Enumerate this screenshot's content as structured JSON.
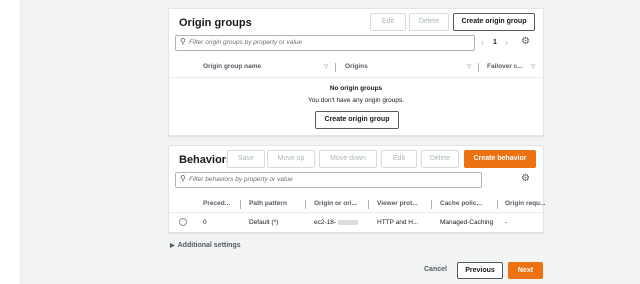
{
  "origin_groups": {
    "title": "Origin groups",
    "edit_label": "Edit",
    "delete_label": "Delete",
    "create_label": "Create origin group",
    "search_placeholder": "Filter origin groups by property or value",
    "page_number": "1",
    "columns": [
      "Origin group name",
      "Origins",
      "Failover c..."
    ],
    "empty_title": "No origin groups",
    "empty_message": "You don't have any origin groups.",
    "empty_create_label": "Create origin group"
  },
  "behaviors": {
    "title": "Behaviors",
    "save_label": "Save",
    "move_up_label": "Move up",
    "move_down_label": "Move down",
    "edit_label": "Edit",
    "delete_label": "Delete",
    "create_label": "Create behavior",
    "search_placeholder": "Filter behaviors by property or value",
    "columns": [
      "Preced...",
      "Path pattern",
      "Origin or ori...",
      "Viewer prot...",
      "Cache polic...",
      "Origin requ..."
    ],
    "rows": [
      {
        "precedence": "0",
        "path_pattern": "Default (*)",
        "origin": "ec2-18-",
        "viewer_protocol": "HTTP and H...",
        "cache_policy": "Managed-Caching",
        "origin_request": "-"
      }
    ]
  },
  "additional_settings": {
    "label": "Additional settings"
  },
  "footer": {
    "cancel_label": "Cancel",
    "previous_label": "Previous",
    "next_label": "Next"
  },
  "colors": {
    "accent": "#ec7211",
    "text": "#16191f",
    "disabled": "#aab7b8"
  },
  "icons": {
    "search": "magnifier",
    "settings": "gear",
    "expand": "triangle-right",
    "prev": "chevron-left",
    "next": "chevron-right"
  }
}
